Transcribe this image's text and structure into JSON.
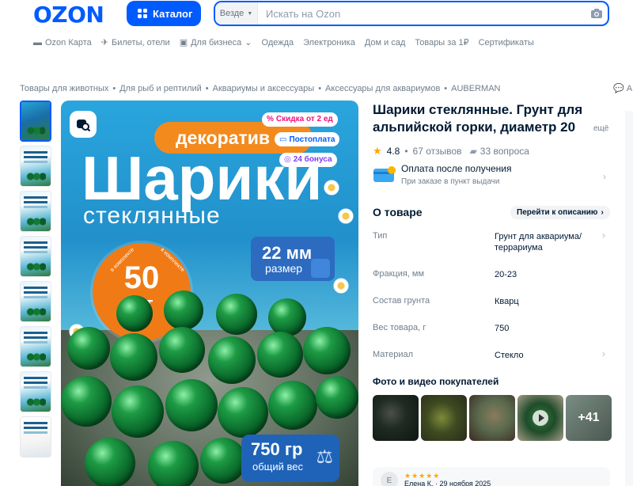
{
  "header": {
    "logo": "OZON",
    "catalog_label": "Каталог",
    "search_scope": "Везде",
    "search_placeholder": "Искать на Ozon"
  },
  "nav": [
    {
      "label": "Ozon Карта",
      "icon": "card-icon"
    },
    {
      "label": "Билеты, отели",
      "icon": "plane-icon"
    },
    {
      "label": "Для бизнеса",
      "icon": "briefcase-icon"
    },
    {
      "label": "Одежда"
    },
    {
      "label": "Электроника"
    },
    {
      "label": "Дом и сад"
    },
    {
      "label": "Товары за 1₽"
    },
    {
      "label": "Сертификаты"
    }
  ],
  "breadcrumbs": [
    "Товары для животных",
    "Для рыб и рептилий",
    "Аквариумы и аксессуары",
    "Аксессуары для аквариумов",
    "AUBERMAN"
  ],
  "share_label": "A",
  "gallery": {
    "orange_label": "декоратив",
    "big_word": "Шарики",
    "sub_word": "стеклянные",
    "count_number": "50",
    "count_unit": "шт",
    "ring_text": "в комплекте",
    "size_value": "22 мм",
    "size_label": "размер",
    "weight_value": "750 гр",
    "weight_label": "общий вес",
    "badges": [
      "Скидка от 2 ед",
      "Постоплата",
      "24 бонуса"
    ]
  },
  "product": {
    "title_line1": "Шарики стеклянные. Грунт для",
    "title_line2": "альпийской горки, диаметр 20",
    "more": "ещё",
    "rating": "4.8",
    "reviews": "67 отзывов",
    "questions": "33 вопроса",
    "payment_title": "Оплата после получения",
    "payment_sub": "При заказе в пункт выдачи"
  },
  "about": {
    "title": "О товаре",
    "to_description": "Перейти к описанию",
    "specs": [
      {
        "key": "Тип",
        "value": "Грунт для аквариума/ террариума"
      },
      {
        "key": "Фракция, мм",
        "value": "20-23"
      },
      {
        "key": "Состав грунта",
        "value": "Кварц"
      },
      {
        "key": "Вес товара, г",
        "value": "750"
      },
      {
        "key": "Материал",
        "value": "Стекло"
      }
    ]
  },
  "ugc": {
    "title": "Фото и видео покупателей",
    "more_count": "+41"
  },
  "review": {
    "avatar": "Е",
    "stars": "★★★★★",
    "author_date": "Елена К. · 29 ноября 2025"
  },
  "colors": {
    "brand": "#005bff",
    "orange": "#f28a1e",
    "star": "#ffa800"
  }
}
